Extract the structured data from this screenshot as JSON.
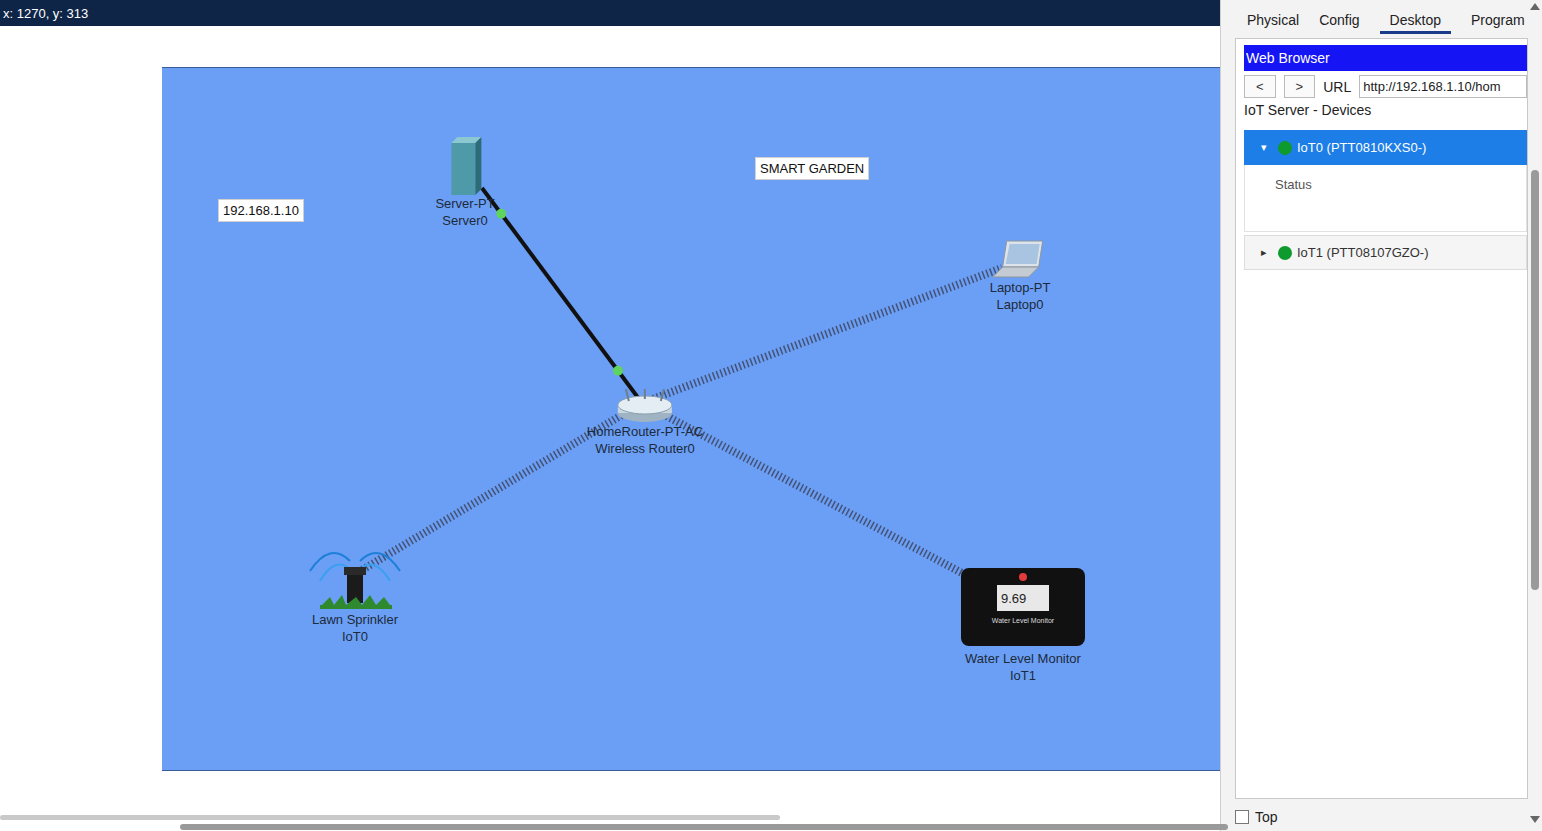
{
  "status": {
    "coordinates": "x: 1270, y: 313"
  },
  "canvas": {
    "notes": [
      "192.168.1.10",
      "SMART GARDEN"
    ]
  },
  "nodes": [
    {
      "kind": "server",
      "model": "Server-PT",
      "name": "Server0"
    },
    {
      "kind": "router",
      "model": "HomeRouter-PT-AC",
      "name": "Wireless Router0"
    },
    {
      "kind": "laptop",
      "model": "Laptop-PT",
      "name": "Laptop0"
    },
    {
      "kind": "sprinkler",
      "model": "Lawn Sprinkler",
      "name": "IoT0"
    },
    {
      "kind": "monitor",
      "model": "Water Level Monitor",
      "name": "IoT1",
      "reading": "9.69"
    }
  ],
  "links": [
    {
      "kind": "wired",
      "from": 0,
      "to": 1,
      "up": true
    },
    {
      "kind": "wireless",
      "from": 1,
      "to": 2,
      "up": true
    },
    {
      "kind": "wireless",
      "from": 1,
      "to": 3,
      "up": true
    },
    {
      "kind": "wireless",
      "from": 1,
      "to": 4,
      "up": true
    }
  ],
  "panel": {
    "tabs": [
      {
        "label": "Physical",
        "selected": false
      },
      {
        "label": "Config",
        "selected": false
      },
      {
        "label": "Desktop",
        "selected": true
      },
      {
        "label": "Program",
        "selected": false
      }
    ],
    "browser": {
      "title": "Web Browser",
      "back": "<",
      "forward": ">",
      "url_label": "URL",
      "url": "http://192.168.1.10/hom",
      "heading": "IoT Server - Devices",
      "devices": [
        {
          "label": "IoT0 (PTT0810KXS0-)",
          "arrow": "▾",
          "expanded": true,
          "selected": true,
          "online": true,
          "details": [
            "Status"
          ]
        },
        {
          "label": "IoT1 (PTT08107GZO-)",
          "arrow": "▸",
          "expanded": false,
          "selected": false,
          "online": true,
          "details": []
        }
      ]
    },
    "top": {
      "label": "Top",
      "checked": false
    }
  }
}
